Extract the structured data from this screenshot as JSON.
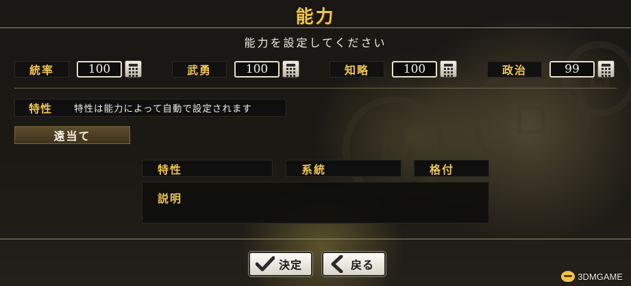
{
  "title": "能力",
  "subtitle": "能力を設定してください",
  "stats": [
    {
      "label": "統率",
      "value": "100"
    },
    {
      "label": "武勇",
      "value": "100"
    },
    {
      "label": "知略",
      "value": "100"
    },
    {
      "label": "政治",
      "value": "99"
    }
  ],
  "trait": {
    "label": "特性",
    "note": "特性は能力によって自動で設定されます",
    "selected": "遠当て"
  },
  "trait_table": {
    "columns": [
      "特性",
      "系統",
      "格付"
    ],
    "description_label": "説明"
  },
  "buttons": {
    "confirm": "決定",
    "back": "戻る"
  },
  "watermark": "3DMGAME",
  "colors": {
    "accent_gold": "#f3c64a",
    "panel": "#0f0f0f",
    "divider": "#9a8f6a"
  }
}
